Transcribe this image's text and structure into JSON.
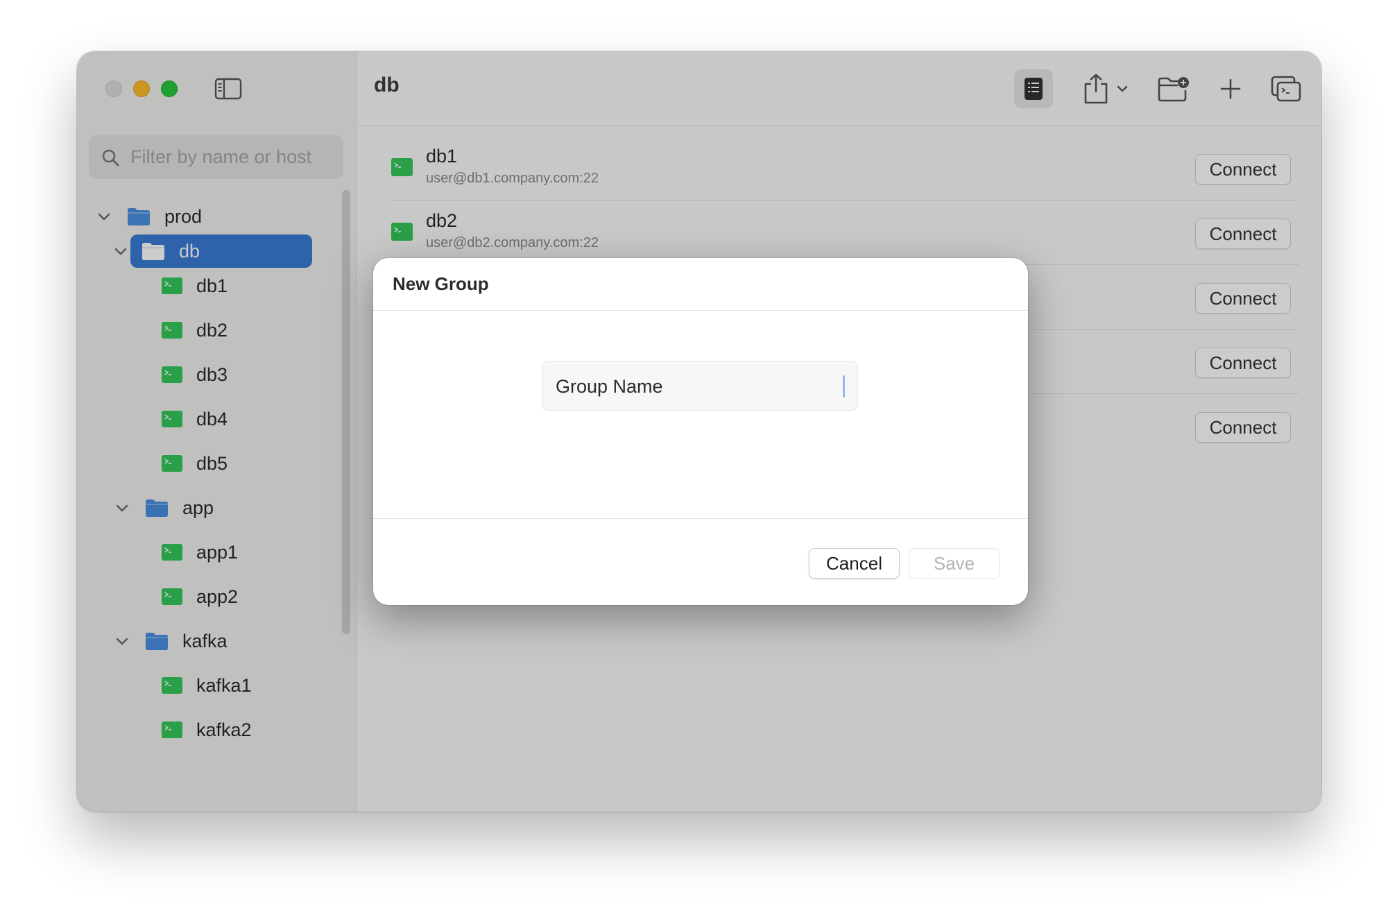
{
  "window": {
    "title": "db"
  },
  "sidebar": {
    "search_placeholder": "Filter by name or host",
    "tree": [
      {
        "label": "prod",
        "kind": "folder"
      },
      {
        "label": "db",
        "kind": "folder",
        "selected": true
      },
      {
        "label": "db1",
        "kind": "host"
      },
      {
        "label": "db2",
        "kind": "host"
      },
      {
        "label": "db3",
        "kind": "host"
      },
      {
        "label": "db4",
        "kind": "host"
      },
      {
        "label": "db5",
        "kind": "host"
      },
      {
        "label": "app",
        "kind": "folder"
      },
      {
        "label": "app1",
        "kind": "host"
      },
      {
        "label": "app2",
        "kind": "host"
      },
      {
        "label": "kafka",
        "kind": "folder"
      },
      {
        "label": "kafka1",
        "kind": "host"
      },
      {
        "label": "kafka2",
        "kind": "host"
      }
    ]
  },
  "toolbar": {
    "icons": [
      "list-view-icon",
      "share-icon",
      "chevron-down-icon",
      "new-folder-icon",
      "plus-icon",
      "terminal-windows-icon"
    ]
  },
  "hosts": [
    {
      "name": "db1",
      "address": "user@db1.company.com:22",
      "action": "Connect"
    },
    {
      "name": "db2",
      "address": "user@db2.company.com:22",
      "action": "Connect"
    },
    {
      "name": "",
      "address": "",
      "action": "Connect"
    },
    {
      "name": "",
      "address": "",
      "action": "Connect"
    },
    {
      "name": "",
      "address": "",
      "action": "Connect"
    }
  ],
  "modal": {
    "title": "New Group",
    "input_placeholder": "Group Name",
    "input_value": "",
    "cancel_label": "Cancel",
    "save_label": "Save"
  },
  "colors": {
    "accent": "#3a7bd5",
    "folder": "#4a8fe0",
    "host_icon": "#34c759"
  }
}
